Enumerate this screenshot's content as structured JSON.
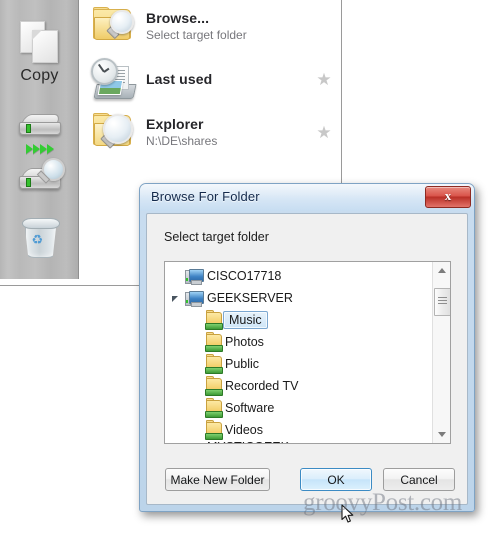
{
  "app": {
    "sidebar": {
      "tools": [
        {
          "label": "Copy",
          "icon": "copy-pages-icon"
        },
        {
          "label": "",
          "icon": "drive-transfer-icon"
        },
        {
          "label": "",
          "icon": "drive-search-icon"
        },
        {
          "label": "",
          "icon": "recycle-bin-icon"
        }
      ]
    },
    "items": [
      {
        "title": "Browse...",
        "subtitle": "Select target folder",
        "icon": "folder-search-icon",
        "star": false,
        "star_glyph": ""
      },
      {
        "title": "Last used",
        "subtitle": "",
        "icon": "clock-history-icon",
        "star": true,
        "star_glyph": "★"
      },
      {
        "title": "Explorer",
        "subtitle": "N:\\DE\\shares",
        "icon": "explorer-magnifier-icon",
        "star": true,
        "star_glyph": "★"
      }
    ]
  },
  "dialog": {
    "title": "Browse For Folder",
    "close_label": "x",
    "close_icon": "close-icon",
    "prompt": "Select target folder",
    "tree": [
      {
        "label": "CISCO17718",
        "icon": "computer-icon",
        "indent": 0,
        "twisty": "collapsed",
        "selected": false
      },
      {
        "label": "GEEKSERVER",
        "icon": "computer-icon",
        "indent": 0,
        "twisty": "expanded",
        "selected": false
      },
      {
        "label": "Music",
        "icon": "shared-folder-icon",
        "indent": 1,
        "twisty": "none",
        "selected": true
      },
      {
        "label": "Photos",
        "icon": "shared-folder-icon",
        "indent": 1,
        "twisty": "collapsed",
        "selected": false
      },
      {
        "label": "Public",
        "icon": "shared-folder-icon",
        "indent": 1,
        "twisty": "collapsed",
        "selected": false
      },
      {
        "label": "Recorded TV",
        "icon": "shared-folder-icon",
        "indent": 1,
        "twisty": "collapsed",
        "selected": false
      },
      {
        "label": "Software",
        "icon": "shared-folder-icon",
        "indent": 1,
        "twisty": "collapsed",
        "selected": false
      },
      {
        "label": "Videos",
        "icon": "shared-folder-icon",
        "indent": 1,
        "twisty": "collapsed",
        "selected": false
      },
      {
        "label": "MYSTICGEEK",
        "icon": "computer-icon",
        "indent": 0,
        "twisty": "collapsed",
        "selected": false,
        "clipped": true
      }
    ],
    "scrollbar": {
      "up_icon": "scroll-up-arrow-icon",
      "down_icon": "scroll-down-arrow-icon"
    },
    "buttons": {
      "new_folder": "Make New Folder",
      "ok": "OK",
      "cancel": "Cancel"
    }
  },
  "watermark": "groovyPost.com",
  "colors": {
    "accent": "#3c8bc4",
    "close_red": "#b92f26",
    "selection": "#cfe6f8",
    "folder_yellow": "#f0c95e",
    "share_green": "#3e9b36"
  }
}
